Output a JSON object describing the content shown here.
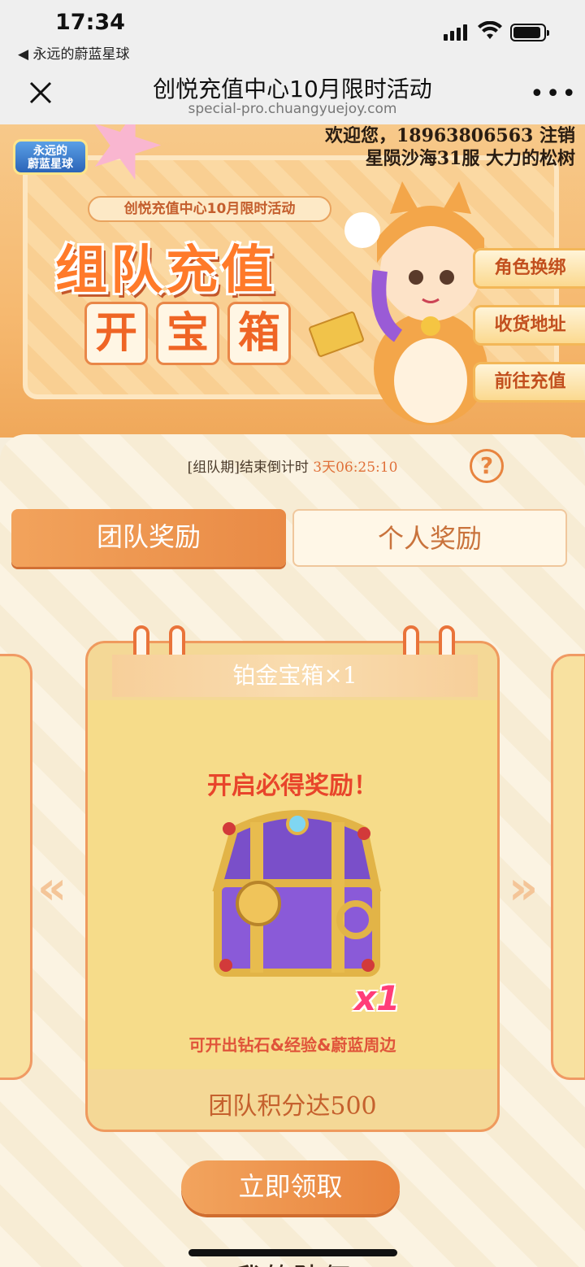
{
  "status_bar": {
    "time": "17:34",
    "back_label": "◀ 永远的蔚蓝星球"
  },
  "nav": {
    "title": "创悦充值中心10月限时活动",
    "url": "special-pro.chuangyuejoy.com",
    "more": "•••"
  },
  "banner": {
    "logo_line1": "永远的",
    "logo_line2": "蔚蓝星球",
    "welcome_line1": "欢迎您，18963806563 注销",
    "welcome_line2": "星陨沙海31服 大力的松树",
    "subtitle": "创悦充值中心10月限时活动",
    "headline": "组队充值",
    "headline2": [
      "开",
      "宝",
      "箱"
    ],
    "side_buttons": [
      "角色换绑",
      "收货地址",
      "前往充值"
    ]
  },
  "countdown": {
    "label": "[组队期]结束倒计时 ",
    "value": "3天06:25:10"
  },
  "help_label": "?",
  "tabs": [
    {
      "label": "团队奖励",
      "active": true
    },
    {
      "label": "个人奖励",
      "active": false
    }
  ],
  "card": {
    "title": "铂金宝箱×1",
    "must_get": "开启必得奖励！",
    "quantity": "x1",
    "description": "可开出钻石&经验&蔚蓝周边",
    "requirement": "团队积分达500"
  },
  "arrows": {
    "left": "«",
    "right": "»"
  },
  "claim_button": "立即领取",
  "my_team": "我的队伍",
  "colors": {
    "accent": "#e98a45",
    "highlight": "#e0713a",
    "card_border": "#ef9a5e"
  }
}
